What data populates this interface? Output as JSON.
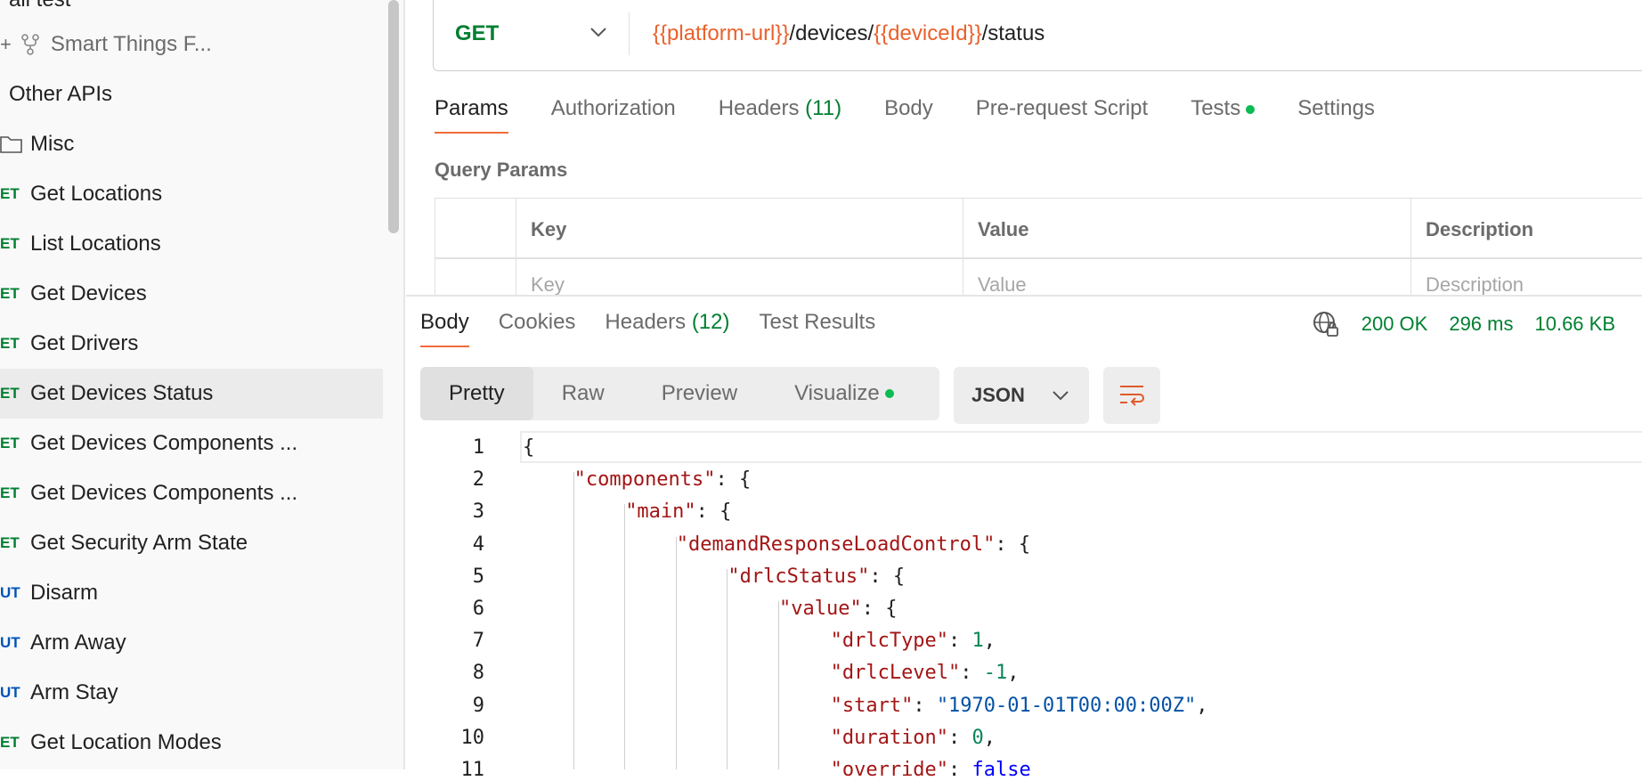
{
  "sidebar": {
    "items": [
      {
        "method": "",
        "label": "ail test",
        "kind": "text"
      },
      {
        "method": "",
        "label": "Smart Things F...",
        "kind": "fork"
      },
      {
        "method": "",
        "label": "Other APIs",
        "kind": "text"
      },
      {
        "method": "",
        "label": "Misc",
        "kind": "folder"
      },
      {
        "method": "GET",
        "label": "Get Locations"
      },
      {
        "method": "GET",
        "label": "List Locations"
      },
      {
        "method": "GET",
        "label": "Get Devices"
      },
      {
        "method": "GET",
        "label": "Get Drivers"
      },
      {
        "method": "GET",
        "label": "Get Devices Status",
        "selected": true
      },
      {
        "method": "GET",
        "label": "Get Devices Components ..."
      },
      {
        "method": "GET",
        "label": "Get Devices Components ..."
      },
      {
        "method": "GET",
        "label": "Get Security Arm State"
      },
      {
        "method": "PUT",
        "label": "Disarm"
      },
      {
        "method": "PUT",
        "label": "Arm Away"
      },
      {
        "method": "PUT",
        "label": "Arm Stay"
      },
      {
        "method": "GET",
        "label": "Get Location Modes"
      }
    ]
  },
  "request": {
    "method": "GET",
    "url_var1": "{{platform-url}}",
    "url_mid": "/devices/",
    "url_var2": "{{deviceId}}",
    "url_end": "/status"
  },
  "request_tabs": {
    "params": "Params",
    "authorization": "Authorization",
    "headers": "Headers",
    "headers_count": "(11)",
    "body": "Body",
    "prerequest": "Pre-request Script",
    "tests": "Tests",
    "settings": "Settings"
  },
  "query_params": {
    "title": "Query Params",
    "columns": [
      "Key",
      "Value",
      "Description"
    ],
    "placeholders": [
      "Key",
      "Value",
      "Description"
    ]
  },
  "response_tabs": {
    "body": "Body",
    "cookies": "Cookies",
    "headers": "Headers",
    "headers_count": "(12)",
    "test_results": "Test Results"
  },
  "response_meta": {
    "status": "200 OK",
    "time": "296 ms",
    "size": "10.66 KB"
  },
  "format": {
    "pretty": "Pretty",
    "raw": "Raw",
    "preview": "Preview",
    "visualize": "Visualize",
    "language": "JSON"
  },
  "code_lines": [
    {
      "n": "1",
      "indent": 0,
      "parts": [
        [
          "p",
          "{"
        ]
      ]
    },
    {
      "n": "2",
      "indent": 1,
      "parts": [
        [
          "k",
          "\"components\""
        ],
        [
          "p",
          ": {"
        ]
      ]
    },
    {
      "n": "3",
      "indent": 2,
      "parts": [
        [
          "k",
          "\"main\""
        ],
        [
          "p",
          ": {"
        ]
      ]
    },
    {
      "n": "4",
      "indent": 3,
      "parts": [
        [
          "k",
          "\"demandResponseLoadControl\""
        ],
        [
          "p",
          ": {"
        ]
      ]
    },
    {
      "n": "5",
      "indent": 4,
      "parts": [
        [
          "k",
          "\"drlcStatus\""
        ],
        [
          "p",
          ": {"
        ]
      ]
    },
    {
      "n": "6",
      "indent": 5,
      "parts": [
        [
          "k",
          "\"value\""
        ],
        [
          "p",
          ": {"
        ]
      ]
    },
    {
      "n": "7",
      "indent": 6,
      "parts": [
        [
          "k",
          "\"drlcType\""
        ],
        [
          "p",
          ": "
        ],
        [
          "n",
          "1"
        ],
        [
          "p",
          ","
        ]
      ]
    },
    {
      "n": "8",
      "indent": 6,
      "parts": [
        [
          "k",
          "\"drlcLevel\""
        ],
        [
          "p",
          ": "
        ],
        [
          "n",
          "-1"
        ],
        [
          "p",
          ","
        ]
      ]
    },
    {
      "n": "9",
      "indent": 6,
      "parts": [
        [
          "k",
          "\"start\""
        ],
        [
          "p",
          ": "
        ],
        [
          "s",
          "\"1970-01-01T00:00:00Z\""
        ],
        [
          "p",
          ","
        ]
      ]
    },
    {
      "n": "10",
      "indent": 6,
      "parts": [
        [
          "k",
          "\"duration\""
        ],
        [
          "p",
          ": "
        ],
        [
          "n",
          "0"
        ],
        [
          "p",
          ","
        ]
      ]
    },
    {
      "n": "11",
      "indent": 6,
      "parts": [
        [
          "k",
          "\"override\""
        ],
        [
          "p",
          ": "
        ],
        [
          "b",
          "false"
        ]
      ]
    }
  ],
  "colors": {
    "get": "#007f31",
    "put": "#0053b8",
    "accent": "#f26b3a",
    "url_var": "#e9612b",
    "status": "#007f31"
  }
}
